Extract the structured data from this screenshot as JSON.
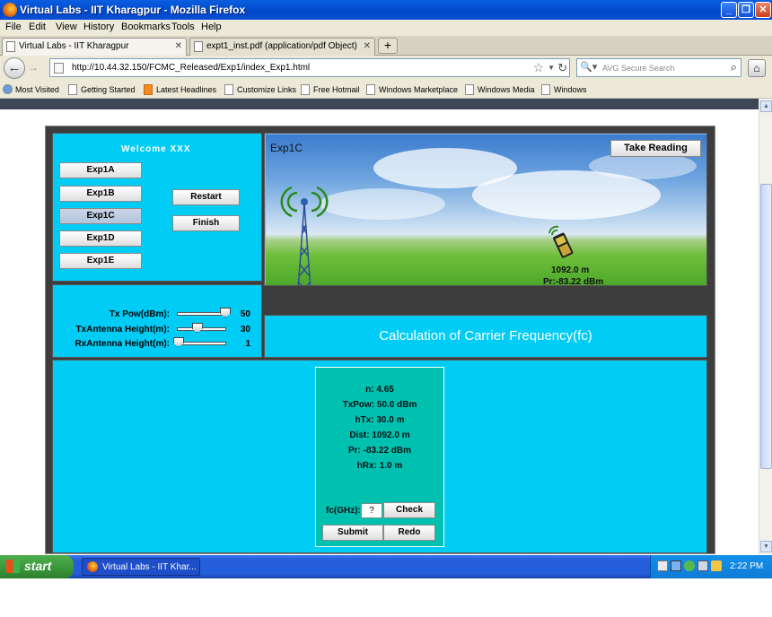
{
  "window": {
    "title": "Virtual Labs - IIT Kharagpur - Mozilla Firefox"
  },
  "menu": [
    "File",
    "Edit",
    "View",
    "History",
    "Bookmarks",
    "Tools",
    "Help"
  ],
  "tabs": [
    {
      "label": "Virtual Labs - IIT Kharagpur",
      "active": true
    },
    {
      "label": "expt1_inst.pdf (application/pdf Object)",
      "active": false
    }
  ],
  "newtab_label": "+",
  "nav": {
    "url": "http://10.44.32.150/FCMC_Released/Exp1/index_Exp1.html",
    "search_placeholder": "AVG Secure Search"
  },
  "bookmarks": [
    "Most Visited",
    "Getting Started",
    "Latest Headlines",
    "Customize Links",
    "Free Hotmail",
    "Windows Marketplace",
    "Windows Media",
    "Windows"
  ],
  "applet": {
    "welcome": "Welcome   XXX",
    "experiments": [
      "Exp1A",
      "Exp1B",
      "Exp1C",
      "Exp1D",
      "Exp1E"
    ],
    "selected_experiment": "Exp1C",
    "restart_label": "Restart",
    "finish_label": "Finish",
    "sliders": [
      {
        "label": "Tx Pow(dBm):",
        "value": "50",
        "fraction": 1.0
      },
      {
        "label": "TxAntenna Height(m):",
        "value": "30",
        "fraction": 0.4
      },
      {
        "label": "RxAntenna Height(m):",
        "value": "1",
        "fraction": 0.0
      }
    ],
    "scene": {
      "title": "Exp1C",
      "take_reading_label": "Take Reading",
      "distance": "1092.0 m",
      "received_power": "Pr:-83.22 dBm"
    },
    "calc_title": "Calculation of Carrier Frequency(fc)",
    "readings": [
      "n: 4.65",
      "TxPow: 50.0 dBm",
      "hTx: 30.0 m",
      "Dist: 1092.0 m",
      "Pr: -83.22 dBm",
      "hRx: 1.0 m"
    ],
    "fc_label": "fc(GHz):",
    "fc_value": "?",
    "check_label": "Check",
    "submit_label": "Submit",
    "redo_label": "Redo"
  },
  "taskbar": {
    "start_label": "start",
    "task_label": "Virtual Labs - IIT Khar...",
    "clock": "2:22 PM"
  },
  "colors": {
    "applet_bg": "#00ccf5",
    "result_box": "#00c0b0",
    "titlebar": "#0047c8",
    "taskbar": "#245edb",
    "start_button": "#3c9a3c"
  }
}
